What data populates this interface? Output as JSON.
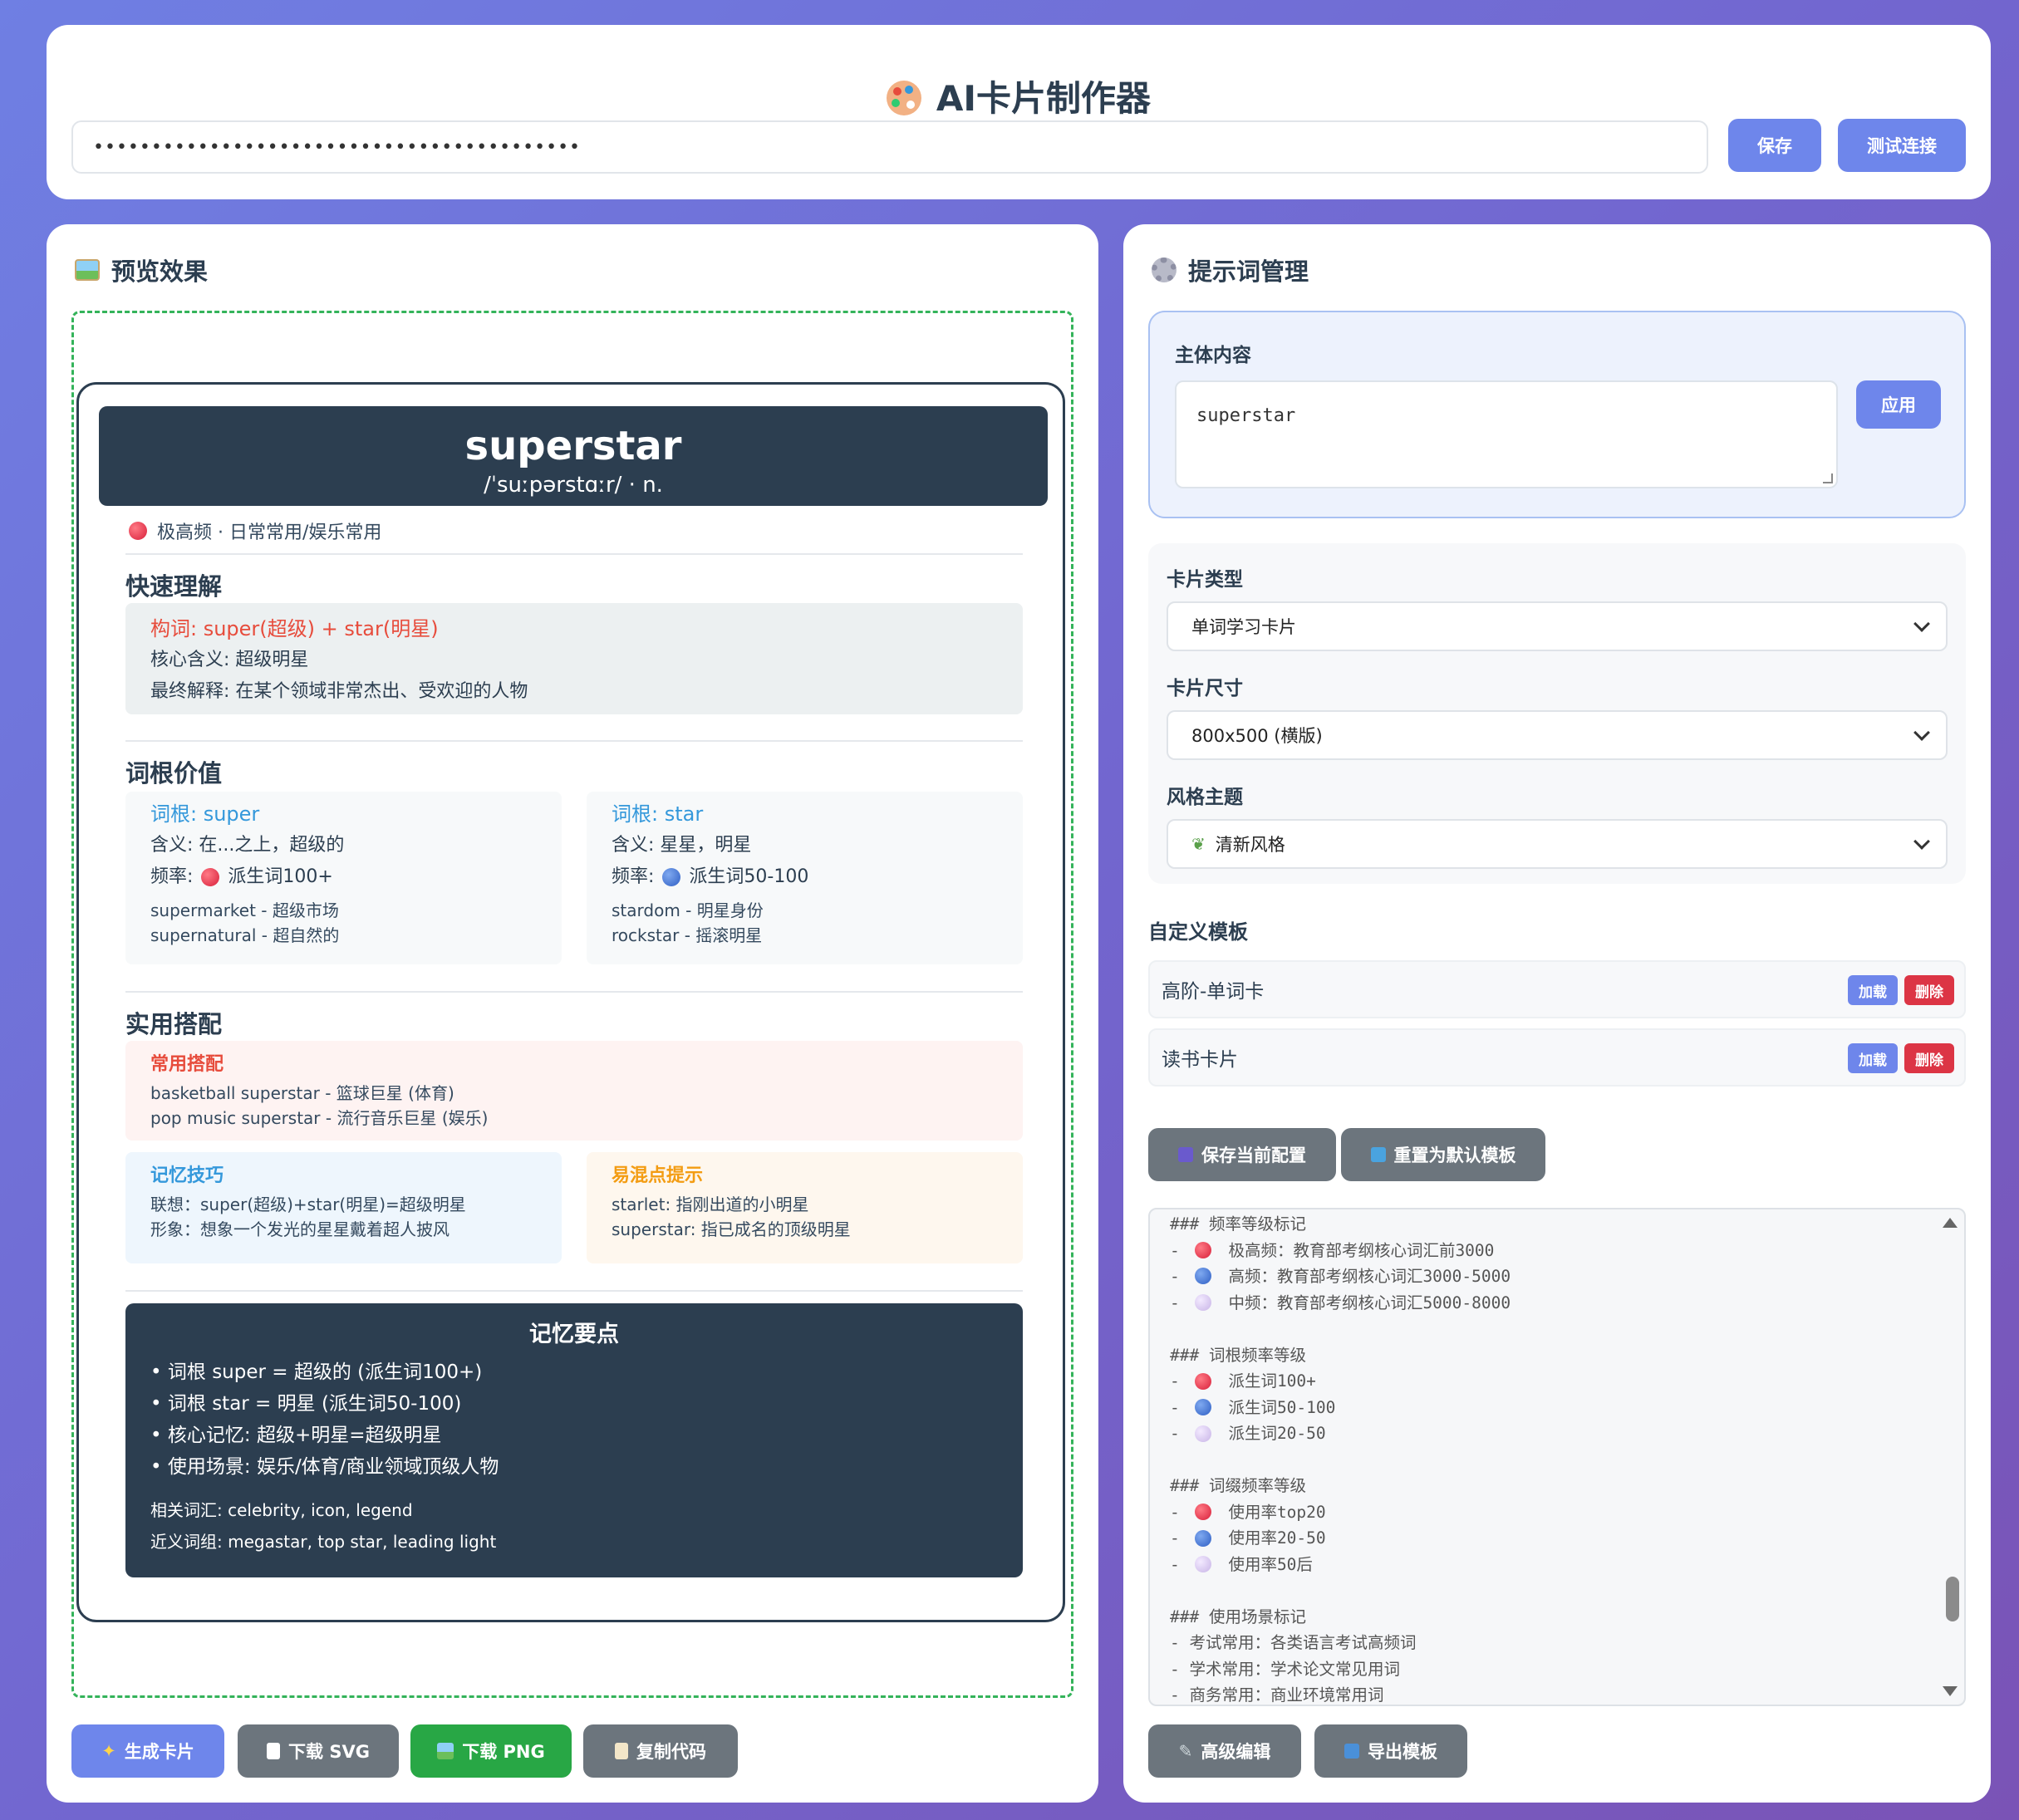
{
  "header": {
    "title": "AI卡片制作器",
    "api_key_value": "••••••••••••••••••••••••••••••••••••••••••",
    "save_label": "保存",
    "test_label": "测试连接"
  },
  "preview": {
    "title": "预览效果",
    "card": {
      "word": "superstar",
      "phonetic": "/ˈsuːpərstɑːr/ · n.",
      "frequency": "极高频 · 日常常用/娱乐常用",
      "quick": {
        "heading": "快速理解",
        "formation": "构词: super(超级) + star(明星)",
        "core": "核心含义: 超级明星",
        "final": "最终解释: 在某个领域非常杰出、受欢迎的人物"
      },
      "roots": {
        "heading": "词根价值",
        "items": [
          {
            "title": "词根: super",
            "meaning": "含义: 在...之上，超级的",
            "freq_prefix": "频率:",
            "freq_text": "派生词100+",
            "examples": [
              "supermarket - 超级市场",
              "supernatural - 超自然的"
            ]
          },
          {
            "title": "词根: star",
            "meaning": "含义: 星星，明星",
            "freq_prefix": "频率:",
            "freq_text": "派生词50-100",
            "examples": [
              "stardom - 明星身份",
              "rockstar - 摇滚明星"
            ]
          }
        ]
      },
      "collocation": {
        "heading": "实用搭配",
        "common_title": "常用搭配",
        "common_lines": [
          "basketball superstar - 篮球巨星 (体育)",
          "pop music superstar - 流行音乐巨星 (娱乐)"
        ],
        "memory_title": "记忆技巧",
        "memory_lines": [
          "联想：super(超级)+star(明星)=超级明星",
          "形象：想象一个发光的星星戴着超人披风"
        ],
        "confuse_title": "易混点提示",
        "confuse_lines": [
          "starlet: 指刚出道的小明星",
          "superstar: 指已成名的顶级明星"
        ]
      },
      "summary": {
        "title": "记忆要点",
        "bullets": [
          "• 词根 super = 超级的 (派生词100+)",
          "• 词根 star = 明星 (派生词50-100)",
          "• 核心记忆: 超级+明星=超级明星",
          "• 使用场景: 娱乐/体育/商业领域顶级人物"
        ],
        "related": "相关词汇: celebrity, icon, legend",
        "phrases": "近义词组: megastar, top star, leading light"
      }
    },
    "buttons": {
      "generate": "生成卡片",
      "svg": "下载 SVG",
      "png": "下载 PNG",
      "copy": "复制代码"
    }
  },
  "prompt": {
    "title": "提示词管理",
    "subject_label": "主体内容",
    "subject_value": "superstar",
    "apply_label": "应用",
    "card_type_label": "卡片类型",
    "card_type_value": "单词学习卡片",
    "card_size_label": "卡片尺寸",
    "card_size_value": "800x500 (横版)",
    "style_label": "风格主题",
    "style_value": "清新风格",
    "custom_label": "自定义模板",
    "templates": [
      {
        "name": "高阶-单词卡",
        "load": "加载",
        "delete": "删除"
      },
      {
        "name": "读书卡片",
        "load": "加载",
        "delete": "删除"
      }
    ],
    "save_config": "保存当前配置",
    "reset_default": "重置为默认模板",
    "editor_lines": [
      "### 频率等级标记",
      "-     极高频：教育部考纲核心词汇前3000",
      "-     高频：教育部考纲核心词汇3000-5000",
      "-     中频：教育部考纲核心词汇5000-8000",
      "",
      "### 词根频率等级",
      "-     派生词100+",
      "-     派生词50-100",
      "-     派生词20-50",
      "",
      "### 词缀频率等级",
      "-     使用率top20",
      "-     使用率20-50",
      "-     使用率50后",
      "",
      "### 使用场景标记",
      "- 考试常用：各类语言考试高频词",
      "- 学术常用：学术论文常见用词",
      "- 商务常用：商业环境常用词"
    ],
    "advanced_edit": "高级编辑",
    "export_template": "导出模板"
  },
  "colors": {
    "accent": "#6e86eb",
    "dark": "#2c3e50",
    "green": "#28a745",
    "gray": "#6c757d",
    "danger": "#dc3545"
  }
}
